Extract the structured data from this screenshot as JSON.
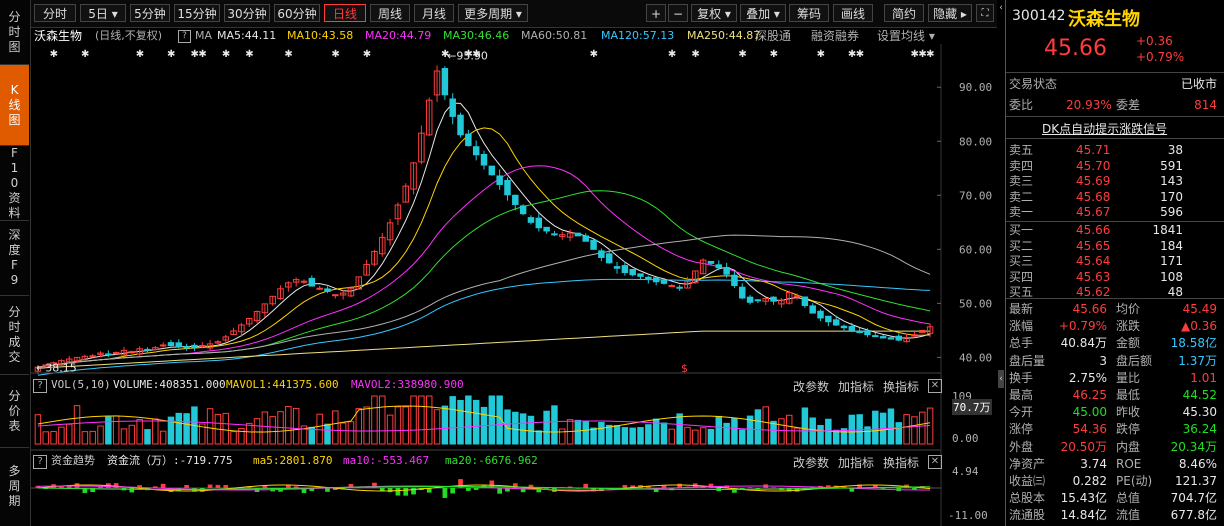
{
  "left_nav": [
    {
      "label": "分时图",
      "active": false
    },
    {
      "label": "K线图",
      "active": true
    },
    {
      "label": "F10资料",
      "active": false
    },
    {
      "label": "深度F9",
      "active": false
    },
    {
      "label": "分时成交",
      "active": false
    },
    {
      "label": "分价表",
      "active": false
    },
    {
      "label": "多周期",
      "active": false
    }
  ],
  "toolbar": {
    "periods": [
      "分时",
      "5日 ▾",
      "5分钟",
      "15分钟",
      "30分钟",
      "60分钟",
      "日线",
      "周线",
      "月线",
      "更多周期 ▾"
    ],
    "active_period": "日线",
    "right_buttons": [
      "+",
      "−",
      "复权 ▾",
      "叠加 ▾",
      "筹码",
      "画线",
      "简约",
      "隐藏 ▸"
    ]
  },
  "main_legend": {
    "stock": "沃森生物",
    "mode": "(日线,不复权)",
    "qmark": "?",
    "ma_label": "MA",
    "ma5": "MA5:44.11",
    "ma10": "MA10:43.58",
    "ma20": "MA20:44.79",
    "ma30": "MA30:46.46",
    "ma60": "MA60:50.81",
    "ma120": "MA120:57.13",
    "ma250": "MA250:44.87",
    "links": [
      "深股通",
      "融资融券",
      "设置均线 ▾"
    ]
  },
  "chart_data": [
    {
      "type": "candlestick",
      "title": "沃森生物 日线",
      "ylim": [
        36,
        98
      ],
      "ytick_labels": [
        "90.00",
        "80.00",
        "70.00",
        "60.00",
        "50.00",
        "40.00"
      ],
      "annotations": [
        "95.90",
        "38.15"
      ],
      "close_series": [
        38.2,
        38.6,
        39.0,
        39.4,
        39.7,
        40.0,
        40.2,
        40.3,
        40.8,
        40.6,
        40.9,
        41.3,
        41.1,
        41.6,
        41.4,
        41.8,
        42.3,
        42.2,
        42.0,
        41.8,
        41.9,
        42.2,
        42.5,
        42.9,
        43.8,
        44.9,
        46.0,
        47.2,
        48.5,
        49.9,
        51.3,
        52.7,
        53.8,
        54.4,
        54.1,
        53.2,
        52.8,
        52.2,
        51.6,
        51.9,
        52.8,
        54.9,
        57.2,
        59.6,
        62.2,
        64.9,
        68.2,
        71.7,
        76.0,
        81.5,
        87.6,
        93.0,
        88.6,
        84.6,
        81.2,
        79.2,
        77.5,
        75.6,
        73.8,
        72.0,
        70.1,
        68.3,
        66.6,
        65.0,
        64.0,
        63.4,
        62.8,
        62.7,
        63.0,
        62.5,
        61.5,
        60.0,
        58.5,
        57.5,
        56.5,
        55.7,
        55.3,
        55.0,
        54.6,
        54.0,
        53.7,
        53.3,
        52.8,
        54.0,
        56.0,
        58.0,
        57.4,
        56.6,
        55.4,
        53.3,
        51.0,
        50.2,
        50.5,
        50.9,
        50.4,
        50.6,
        52.0,
        51.4,
        49.6,
        48.2,
        47.3,
        46.6,
        46.0,
        45.5,
        45.0,
        44.6,
        44.2,
        43.9,
        43.6,
        43.4,
        43.2,
        43.7,
        44.2,
        45.0,
        45.66
      ]
    },
    {
      "type": "bar",
      "title": "VOL(5,10)",
      "ylim": [
        0,
        109
      ],
      "ytick_labels": [
        "109",
        "70.7万",
        "0.00"
      ]
    },
    {
      "type": "bar",
      "title": "资金趋势",
      "ylim": [
        -11,
        4.94
      ],
      "ytick_labels": [
        "4.94",
        "-11.00"
      ]
    }
  ],
  "vol_panel": {
    "title": "VOL(5,10)",
    "volume": "VOLUME:408351.000",
    "mavol1": "MAVOL1:441375.600",
    "mavol2": "MAVOL2:338980.900",
    "buttons": [
      "改参数",
      "加指标",
      "换指标"
    ],
    "scale_top": "109",
    "scale_mid": "70.7万",
    "scale_bot": "0.00"
  },
  "flow_panel": {
    "title": "资金趋势",
    "flow": "资金流（万）:-719.775",
    "ma5": "ma5:2801.870",
    "ma10": "ma10:-553.467",
    "ma20": "ma20:-6676.962",
    "buttons": [
      "改参数",
      "加指标",
      "换指标"
    ],
    "scale_top": "4.94",
    "scale_bot": "-11.00"
  },
  "right_panel": {
    "code": "300142",
    "name": "沃森生物",
    "price": "45.66",
    "change": "+0.36",
    "change_pct": "+0.79%",
    "trade_status_label": "交易状态",
    "trade_status": "已收市",
    "webi_label": "委比",
    "webi": "20.93%",
    "weicha_label": "委差",
    "weicha": "814",
    "dk_signal": "DK点自动提示涨跌信号",
    "asks": [
      {
        "label": "卖五",
        "price": "45.71",
        "vol": "38"
      },
      {
        "label": "卖四",
        "price": "45.70",
        "vol": "591"
      },
      {
        "label": "卖三",
        "price": "45.69",
        "vol": "143"
      },
      {
        "label": "卖二",
        "price": "45.68",
        "vol": "170"
      },
      {
        "label": "卖一",
        "price": "45.67",
        "vol": "596"
      }
    ],
    "bids": [
      {
        "label": "买一",
        "price": "45.66",
        "vol": "1841"
      },
      {
        "label": "买二",
        "price": "45.65",
        "vol": "184"
      },
      {
        "label": "买三",
        "price": "45.64",
        "vol": "171"
      },
      {
        "label": "买四",
        "price": "45.63",
        "vol": "108"
      },
      {
        "label": "买五",
        "price": "45.62",
        "vol": "48"
      }
    ],
    "stats": [
      {
        "l1": "最新",
        "v1": "45.66",
        "c1": "red",
        "l2": "均价",
        "v2": "45.49",
        "c2": "red"
      },
      {
        "l1": "涨幅",
        "v1": "+0.79%",
        "c1": "red",
        "l2": "涨跌",
        "v2": "▲0.36",
        "c2": "red"
      },
      {
        "l1": "总手",
        "v1": "40.84万",
        "c1": "white",
        "l2": "金额",
        "v2": "18.58亿",
        "c2": "cyan"
      },
      {
        "l1": "盘后量",
        "v1": "3",
        "c1": "white",
        "l2": "盘后额",
        "v2": "1.37万",
        "c2": "cyan"
      },
      {
        "l1": "换手",
        "v1": "2.75%",
        "c1": "white",
        "l2": "量比",
        "v2": "1.01",
        "c2": "red"
      },
      {
        "l1": "最高",
        "v1": "46.25",
        "c1": "red",
        "l2": "最低",
        "v2": "44.52",
        "c2": "green"
      },
      {
        "l1": "今开",
        "v1": "45.00",
        "c1": "green",
        "l2": "昨收",
        "v2": "45.30",
        "c2": "white"
      },
      {
        "l1": "涨停",
        "v1": "54.36",
        "c1": "red",
        "l2": "跌停",
        "v2": "36.24",
        "c2": "green"
      },
      {
        "l1": "外盘",
        "v1": "20.50万",
        "c1": "red",
        "l2": "内盘",
        "v2": "20.34万",
        "c2": "green"
      },
      {
        "l1": "净资产",
        "v1": "3.74",
        "c1": "white",
        "l2": "ROE",
        "v2": "8.46%",
        "c2": "white"
      },
      {
        "l1": "收益㈢",
        "v1": "0.282",
        "c1": "white",
        "l2": "PE(动)",
        "v2": "121.37",
        "c2": "white"
      },
      {
        "l1": "总股本",
        "v1": "15.43亿",
        "c1": "white",
        "l2": "总值",
        "v2": "704.7亿",
        "c2": "white"
      },
      {
        "l1": "流通股",
        "v1": "14.84亿",
        "c1": "white",
        "l2": "流值",
        "v2": "677.8亿",
        "c2": "white"
      }
    ]
  },
  "colors": {
    "up": "#ff3c3c",
    "down": "#20c8d8",
    "ma5": "#e8e8e8",
    "ma10": "#ffd400",
    "ma20": "#ff30ff",
    "ma30": "#30e030",
    "ma60": "#b0b0b0",
    "ma120": "#35c8ff",
    "ma250": "#f0e080"
  }
}
